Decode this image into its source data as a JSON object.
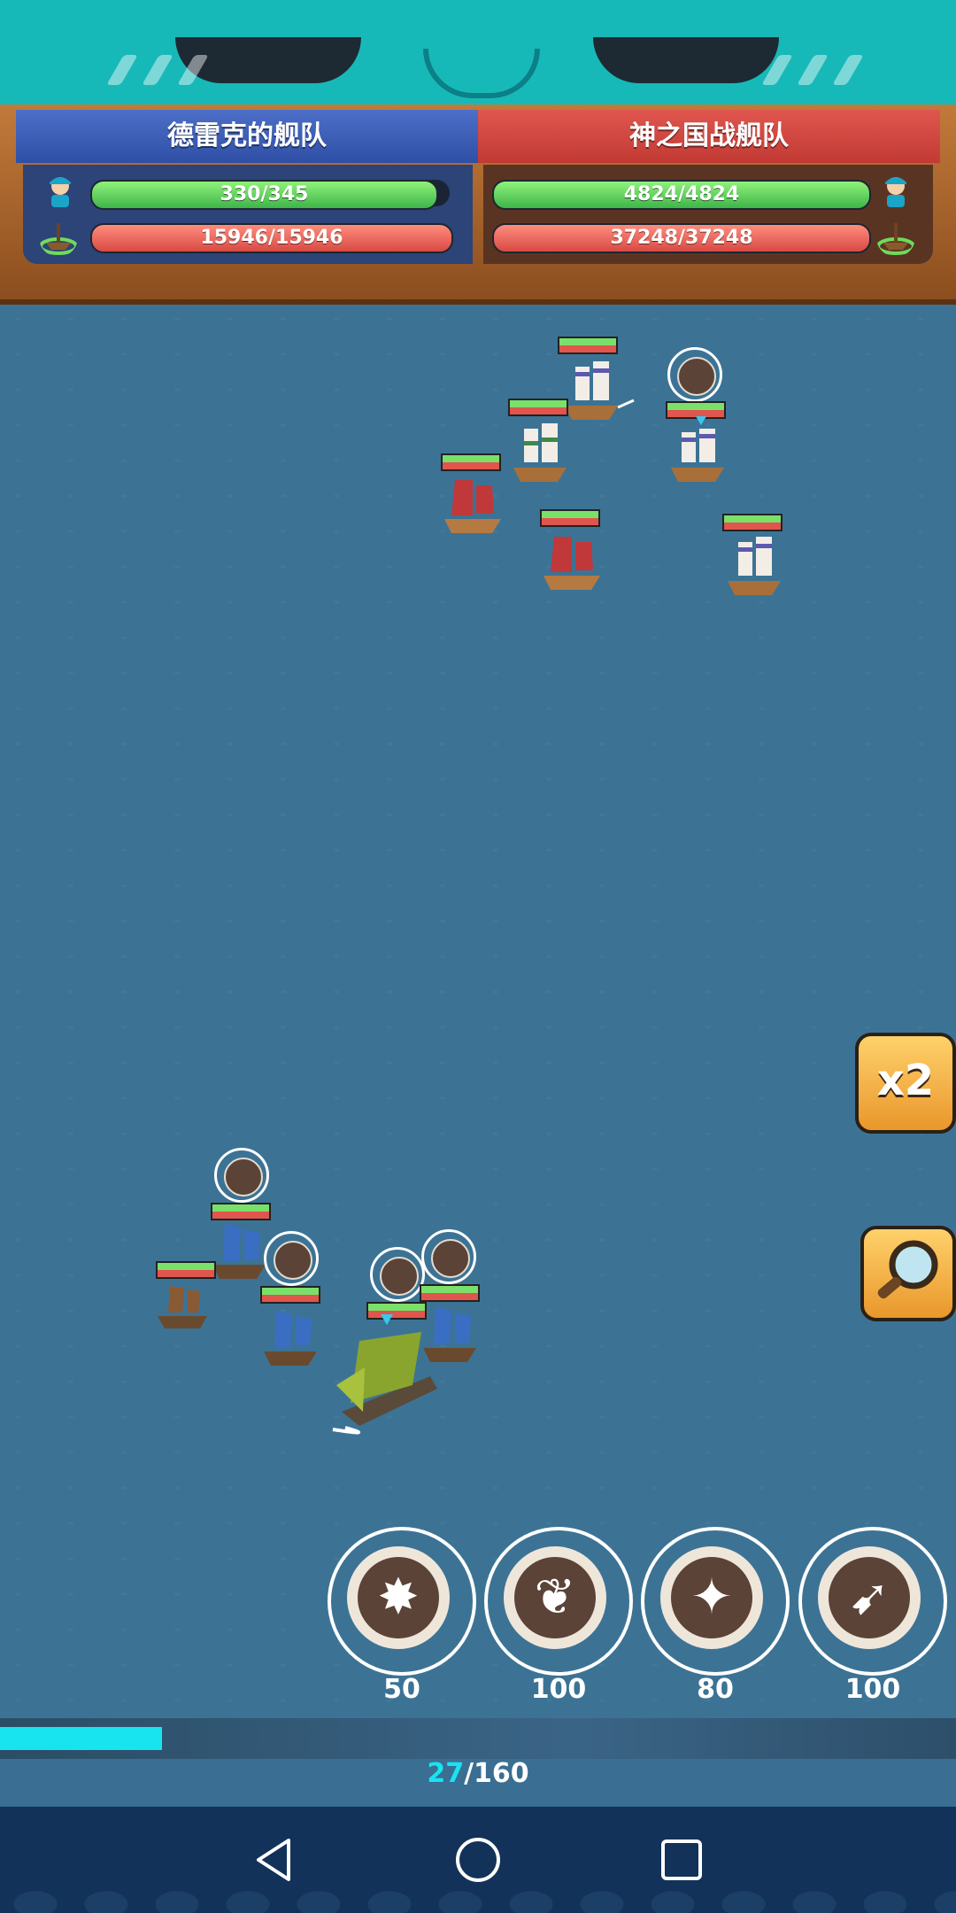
{
  "header": {
    "left_team": {
      "name": "德雷克的舰队",
      "crew": "330/345",
      "crew_fill": 0.957,
      "hull": "15946/15946",
      "hull_fill": 1.0,
      "color": "#3857b4"
    },
    "right_team": {
      "name": "神之国战舰队",
      "crew": "4824/4824",
      "crew_fill": 1.0,
      "hull": "37248/37248",
      "hull_fill": 1.0,
      "color": "#d8463f"
    }
  },
  "side_buttons": {
    "speed_label": "x2",
    "zoom_icon": "magnifier-icon"
  },
  "skills": [
    {
      "cost": "50",
      "icon": "explosion-icon"
    },
    {
      "cost": "100",
      "icon": "wings-icon"
    },
    {
      "cost": "80",
      "icon": "star-burst-icon"
    },
    {
      "cost": "100",
      "icon": "charge-icon"
    }
  ],
  "energy": {
    "current": "27",
    "separator": "/",
    "max": "160",
    "fill": 0.169
  },
  "colors": {
    "sea": "#3c7395",
    "energy": "#18e4f0",
    "mascot": "#17b9b8"
  },
  "navbar": {
    "icons": [
      "back-icon",
      "home-icon",
      "recents-icon"
    ]
  }
}
